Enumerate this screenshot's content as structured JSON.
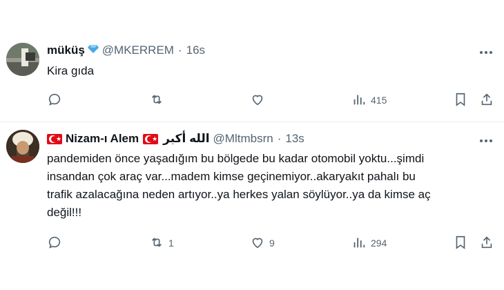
{
  "tweets": [
    {
      "name": "müküş",
      "handle": "@MKERREM",
      "time": "16s",
      "text": "Kira gıda",
      "stats": {
        "replies": "",
        "retweets": "",
        "likes": "",
        "views": "415"
      }
    },
    {
      "name": "Nizam-ı Alem",
      "arabic": "الله أكبر",
      "handle": "@Mltmbsrn",
      "time": "13s",
      "text_lines": [
        "pandemiden önce yaşadığım bu bölgede bu kadar otomobil yoktu...şimdi",
        "insandan çok araç var...madem kimse geçinemiyor..akaryakıt pahalı bu",
        "trafik azalacağına neden artıyor..ya herkes yalan söylüyor..ya da kimse aç",
        "değil!!!"
      ],
      "stats": {
        "replies": "",
        "retweets": "1",
        "likes": "9",
        "views": "294"
      }
    }
  ],
  "separator": "·",
  "colors": {
    "text": "#0f1419",
    "muted": "#536471",
    "border": "#e6ecf0",
    "flag_red": "#e30a17",
    "gem_blue": "#4aa8e8"
  }
}
